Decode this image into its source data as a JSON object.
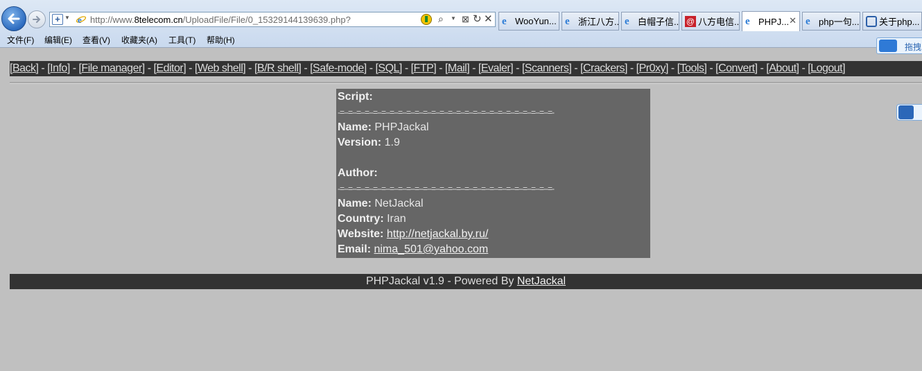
{
  "browser": {
    "url_prefix": "http://www.",
    "url_domain": "8telecom.cn",
    "url_path": "/UploadFile/File/0_15329144139639.php?",
    "tabs": [
      {
        "label": "WooYun...",
        "icon": "ie-icon"
      },
      {
        "label": "浙江八方...",
        "icon": "ie-icon"
      },
      {
        "label": "白帽子信...",
        "icon": "ie-icon"
      },
      {
        "label": "八方电信...",
        "icon": "mail-at-icon"
      },
      {
        "label": "PHPJ...",
        "icon": "ie-icon",
        "active": true
      },
      {
        "label": "php一句...",
        "icon": "ie-icon"
      },
      {
        "label": "关于php...",
        "icon": "search-icon"
      }
    ],
    "menu": [
      "文件(F)",
      "编辑(E)",
      "查看(V)",
      "收藏夹(A)",
      "工具(T)",
      "帮助(H)"
    ],
    "side_badge": "拖拽"
  },
  "nav": {
    "links": [
      "[Back]",
      "[Info]",
      "[File manager]",
      "[Editor]",
      "[Web shell]",
      "[B/R shell]",
      "[Safe-mode]",
      "[SQL]",
      "[FTP]",
      "[Mail]",
      "[Evaler]",
      "[Scanners]",
      "[Crackers]",
      "[Pr0xy]",
      "[Tools]",
      "[Convert]",
      "[About]",
      "[Logout]"
    ],
    "separator": " - "
  },
  "about": {
    "script_heading": "Script:",
    "separator": "-=--=--=--=--=--=--=--=--=--=--=--=--=--=--=--=--=--=--=--=--=--=--=--=--=--=-",
    "name_label": "Name:",
    "script_name": "PHPJackal",
    "version_label": "Version:",
    "version": "1.9",
    "author_heading": "Author:",
    "author_name": "NetJackal",
    "country_label": "Country:",
    "country": "Iran",
    "website_label": "Website:",
    "website": "http://netjackal.by.ru/",
    "email_label": "Email:",
    "email": "nima_501@yahoo.com"
  },
  "footer": {
    "text": "PHPJackal v1.9 - Powered By ",
    "link": "NetJackal"
  },
  "colors": {
    "page_bg": "#c0c0c0",
    "bar_bg": "#333333",
    "box_bg": "#666666"
  }
}
